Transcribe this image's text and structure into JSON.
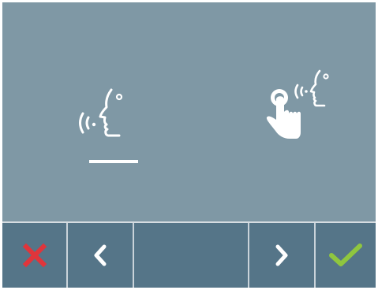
{
  "screen": {
    "background_color": "#7f98a5",
    "toolbar_color": "#557588"
  },
  "modes": [
    {
      "id": "hands-free",
      "icon": "hands-free-talk-icon",
      "selected": true
    },
    {
      "id": "push-to-talk",
      "icon": "push-to-talk-icon",
      "selected": false
    }
  ],
  "toolbar": {
    "buttons": [
      {
        "id": "cancel",
        "icon": "cross-icon",
        "color": "#e0353b"
      },
      {
        "id": "previous",
        "icon": "chevron-left-icon",
        "color": "#ffffff"
      },
      {
        "id": "blank",
        "icon": "",
        "color": ""
      },
      {
        "id": "next",
        "icon": "chevron-right-icon",
        "color": "#ffffff"
      },
      {
        "id": "confirm",
        "icon": "checkmark-icon",
        "color": "#8fc63f"
      }
    ]
  }
}
